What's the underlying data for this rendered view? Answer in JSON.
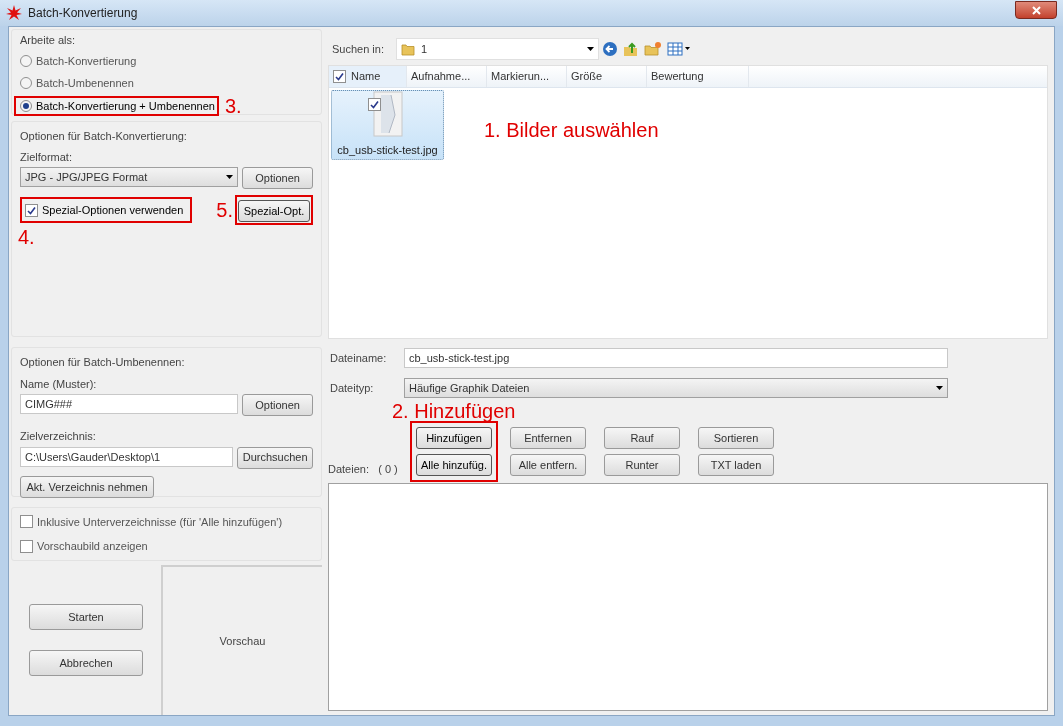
{
  "window": {
    "title": "Batch-Konvertierung"
  },
  "mode_group": {
    "label": "Arbeite als:",
    "options": [
      {
        "label": "Batch-Konvertierung",
        "selected": false,
        "highlighted": false
      },
      {
        "label": "Batch-Umbenennen",
        "selected": false,
        "highlighted": false
      },
      {
        "label": "Batch-Konvertierung + Umbenennen",
        "selected": true,
        "highlighted": true,
        "annotation": "3."
      }
    ]
  },
  "conversion": {
    "label": "Optionen für Batch-Konvertierung:",
    "format_label": "Zielformat:",
    "format_value": "JPG - JPG/JPEG Format",
    "options_button": "Optionen",
    "special_checkbox": {
      "label": "Spezial-Optionen verwenden",
      "checked": true,
      "highlighted": true,
      "annotation": "4."
    },
    "special_button": {
      "label": "Spezial-Opt.",
      "highlighted": true,
      "annotation": "5."
    }
  },
  "rename": {
    "label": "Optionen für Batch-Umbenennen:",
    "name_label": "Name (Muster):",
    "name_value": "CIMG###",
    "options_button": "Optionen",
    "target_label": "Zielverzeichnis:",
    "target_value": "C:\\Users\\Gauder\\Desktop\\1",
    "browse_button": "Durchsuchen",
    "current_dir_button": "Akt. Verzeichnis nehmen"
  },
  "extra_checkboxes": [
    {
      "label": "Inklusive Unterverzeichnisse (für 'Alle hinzufügen')",
      "checked": false
    },
    {
      "label": "Vorschaubild anzeigen",
      "checked": false
    }
  ],
  "action_buttons": [
    "Starten",
    "Abbrechen"
  ],
  "preview": {
    "label": "Vorschau"
  },
  "browser": {
    "look_in_label": "Suchen in:",
    "look_in_value": "1",
    "select_all_checked": true,
    "columns": [
      "Name",
      "Aufnahme...",
      "Markierun...",
      "Größe",
      "Bewertung"
    ],
    "files": [
      {
        "name": "cb_usb-stick-test.jpg",
        "checked": true,
        "selected": true
      }
    ],
    "annotation": "1. Bilder auswählen",
    "filename_label": "Dateiname:",
    "filename_value": "cb_usb-stick-test.jpg",
    "filetype_label": "Dateityp:",
    "filetype_value": "Häufige Graphik Dateien"
  },
  "file_buttons": {
    "annotation": "2. Hinzufügen",
    "columns": [
      {
        "highlighted": true,
        "buttons": [
          "Hinzufügen",
          "Alle hinzufüg."
        ]
      },
      {
        "highlighted": false,
        "buttons": [
          "Entfernen",
          "Alle entfern."
        ]
      },
      {
        "highlighted": false,
        "buttons": [
          "Rauf",
          "Runter"
        ]
      },
      {
        "highlighted": false,
        "buttons": [
          "Sortieren",
          "TXT laden"
        ]
      }
    ]
  },
  "files_list": {
    "label": "Dateien:",
    "count": "( 0 )"
  }
}
